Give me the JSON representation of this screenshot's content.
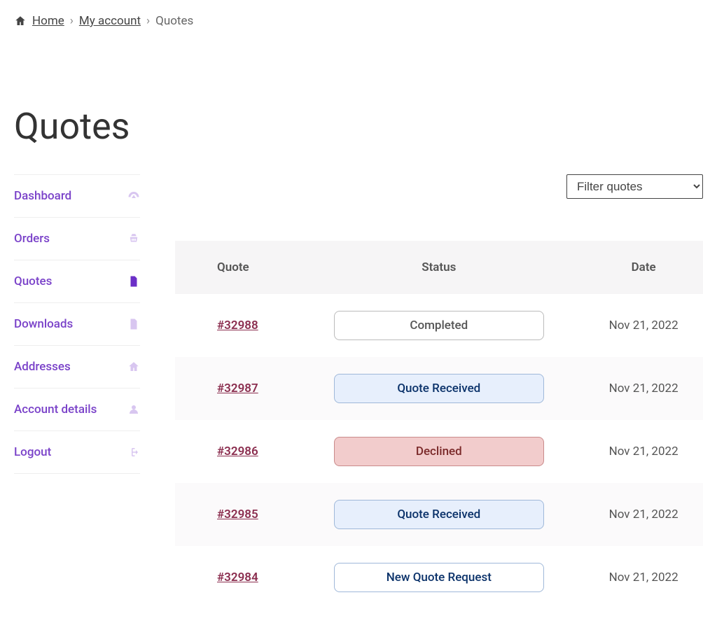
{
  "breadcrumb": {
    "home": "Home",
    "account": "My account",
    "current": "Quotes"
  },
  "page_title": "Quotes",
  "sidebar": {
    "items": [
      {
        "label": "Dashboard",
        "icon": "dashboard"
      },
      {
        "label": "Orders",
        "icon": "cart"
      },
      {
        "label": "Quotes",
        "icon": "file",
        "active": true
      },
      {
        "label": "Downloads",
        "icon": "download"
      },
      {
        "label": "Addresses",
        "icon": "home"
      },
      {
        "label": "Account details",
        "icon": "user"
      },
      {
        "label": "Logout",
        "icon": "logout"
      }
    ]
  },
  "filter": {
    "selected": "Filter quotes"
  },
  "table": {
    "headers": {
      "quote": "Quote",
      "status": "Status",
      "date": "Date"
    },
    "rows": [
      {
        "id": "#32988",
        "status": "Completed",
        "status_class": "completed",
        "date": "Nov 21, 2022"
      },
      {
        "id": "#32987",
        "status": "Quote Received",
        "status_class": "quote-received",
        "date": "Nov 21, 2022"
      },
      {
        "id": "#32986",
        "status": "Declined",
        "status_class": "declined",
        "date": "Nov 21, 2022"
      },
      {
        "id": "#32985",
        "status": "Quote Received",
        "status_class": "quote-received",
        "date": "Nov 21, 2022"
      },
      {
        "id": "#32984",
        "status": "New Quote Request",
        "status_class": "new-quote-request",
        "date": "Nov 21, 2022"
      }
    ]
  }
}
